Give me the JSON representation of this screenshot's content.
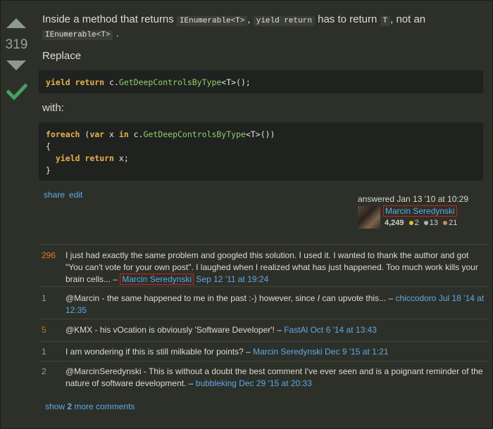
{
  "vote": {
    "count": "319",
    "accepted": true
  },
  "post": {
    "line1_pre": "Inside a method that returns ",
    "code1": "IEnumerable<T>",
    "line1_mid": ", ",
    "code2": "yield return",
    "line1_mid2": " has to return ",
    "code3": "T",
    "line1_post": ", not an",
    "code4": "IEnumerable<T>",
    "line2_post": ".",
    "replace": "Replace",
    "code_block1": {
      "kw1": "yield",
      "kw2": "return",
      "plain": " c.",
      "fn": "GetDeepControlsByType",
      "tail": "<T>();"
    },
    "with": "with:",
    "code_block2": {
      "line1_kw1": "foreach",
      "line1_a": " (",
      "line1_kw2": "var",
      "line1_b": " x ",
      "line1_kw3": "in",
      "line1_c": " c.",
      "line1_fn": "GetDeepControlsByType",
      "line1_d": "<T>())",
      "line2": "{",
      "line3_kw1": "yield",
      "line3_kw2": "return",
      "line3_tail": " x;",
      "line4": "}"
    }
  },
  "menu": {
    "share": "share",
    "edit": "edit"
  },
  "signature": {
    "action": "answered Jan 13 '10 at 10:29",
    "user": "Marcin Seredynski",
    "reputation": "4,249",
    "gold": "2",
    "silver": "13",
    "bronze": "21",
    "colors": {
      "gold": "#e8c020",
      "silver": "#b0b4b8",
      "bronze": "#c88a5a"
    }
  },
  "comments": [
    {
      "score": "296",
      "text": "I just had exactly the same problem and googled this solution. I used it. I wanted to thank the author and got \"You can't vote for your own post\". I laughed when I realized what has just happened. Too much work kills your brain cells... – ",
      "user": "Marcin Seredynski",
      "date": "Sep 12 '11 at 19:24"
    },
    {
      "score": "1",
      "text_a": "@Marcin - the same happened to me in the past :-) however, since ",
      "text_em": "I",
      "text_b": " can upvote this... – ",
      "user": "chiccodoro",
      "date": "Jul 18 '14 at 12:35"
    },
    {
      "score": "5",
      "text": "@KMX - his vOcation is obviously 'Software Developer'! – ",
      "user": "FastAl",
      "date": "Oct 6 '14 at 13:43"
    },
    {
      "score": "1",
      "text": "I am wondering if this is still milkable for points? – ",
      "user": "Marcin Seredynski",
      "date": "Dec 9 '15 at 1:21"
    },
    {
      "score": "2",
      "text": "@MarcinSeredynski - This is without a doubt the best comment I've ever seen and is a poignant reminder of the nature of software development. – ",
      "user": "bubbleking",
      "date": "Dec 29 '15 at 20:33"
    }
  ],
  "more_comments": {
    "pre": "show ",
    "count": "2",
    "post": " more comments"
  }
}
